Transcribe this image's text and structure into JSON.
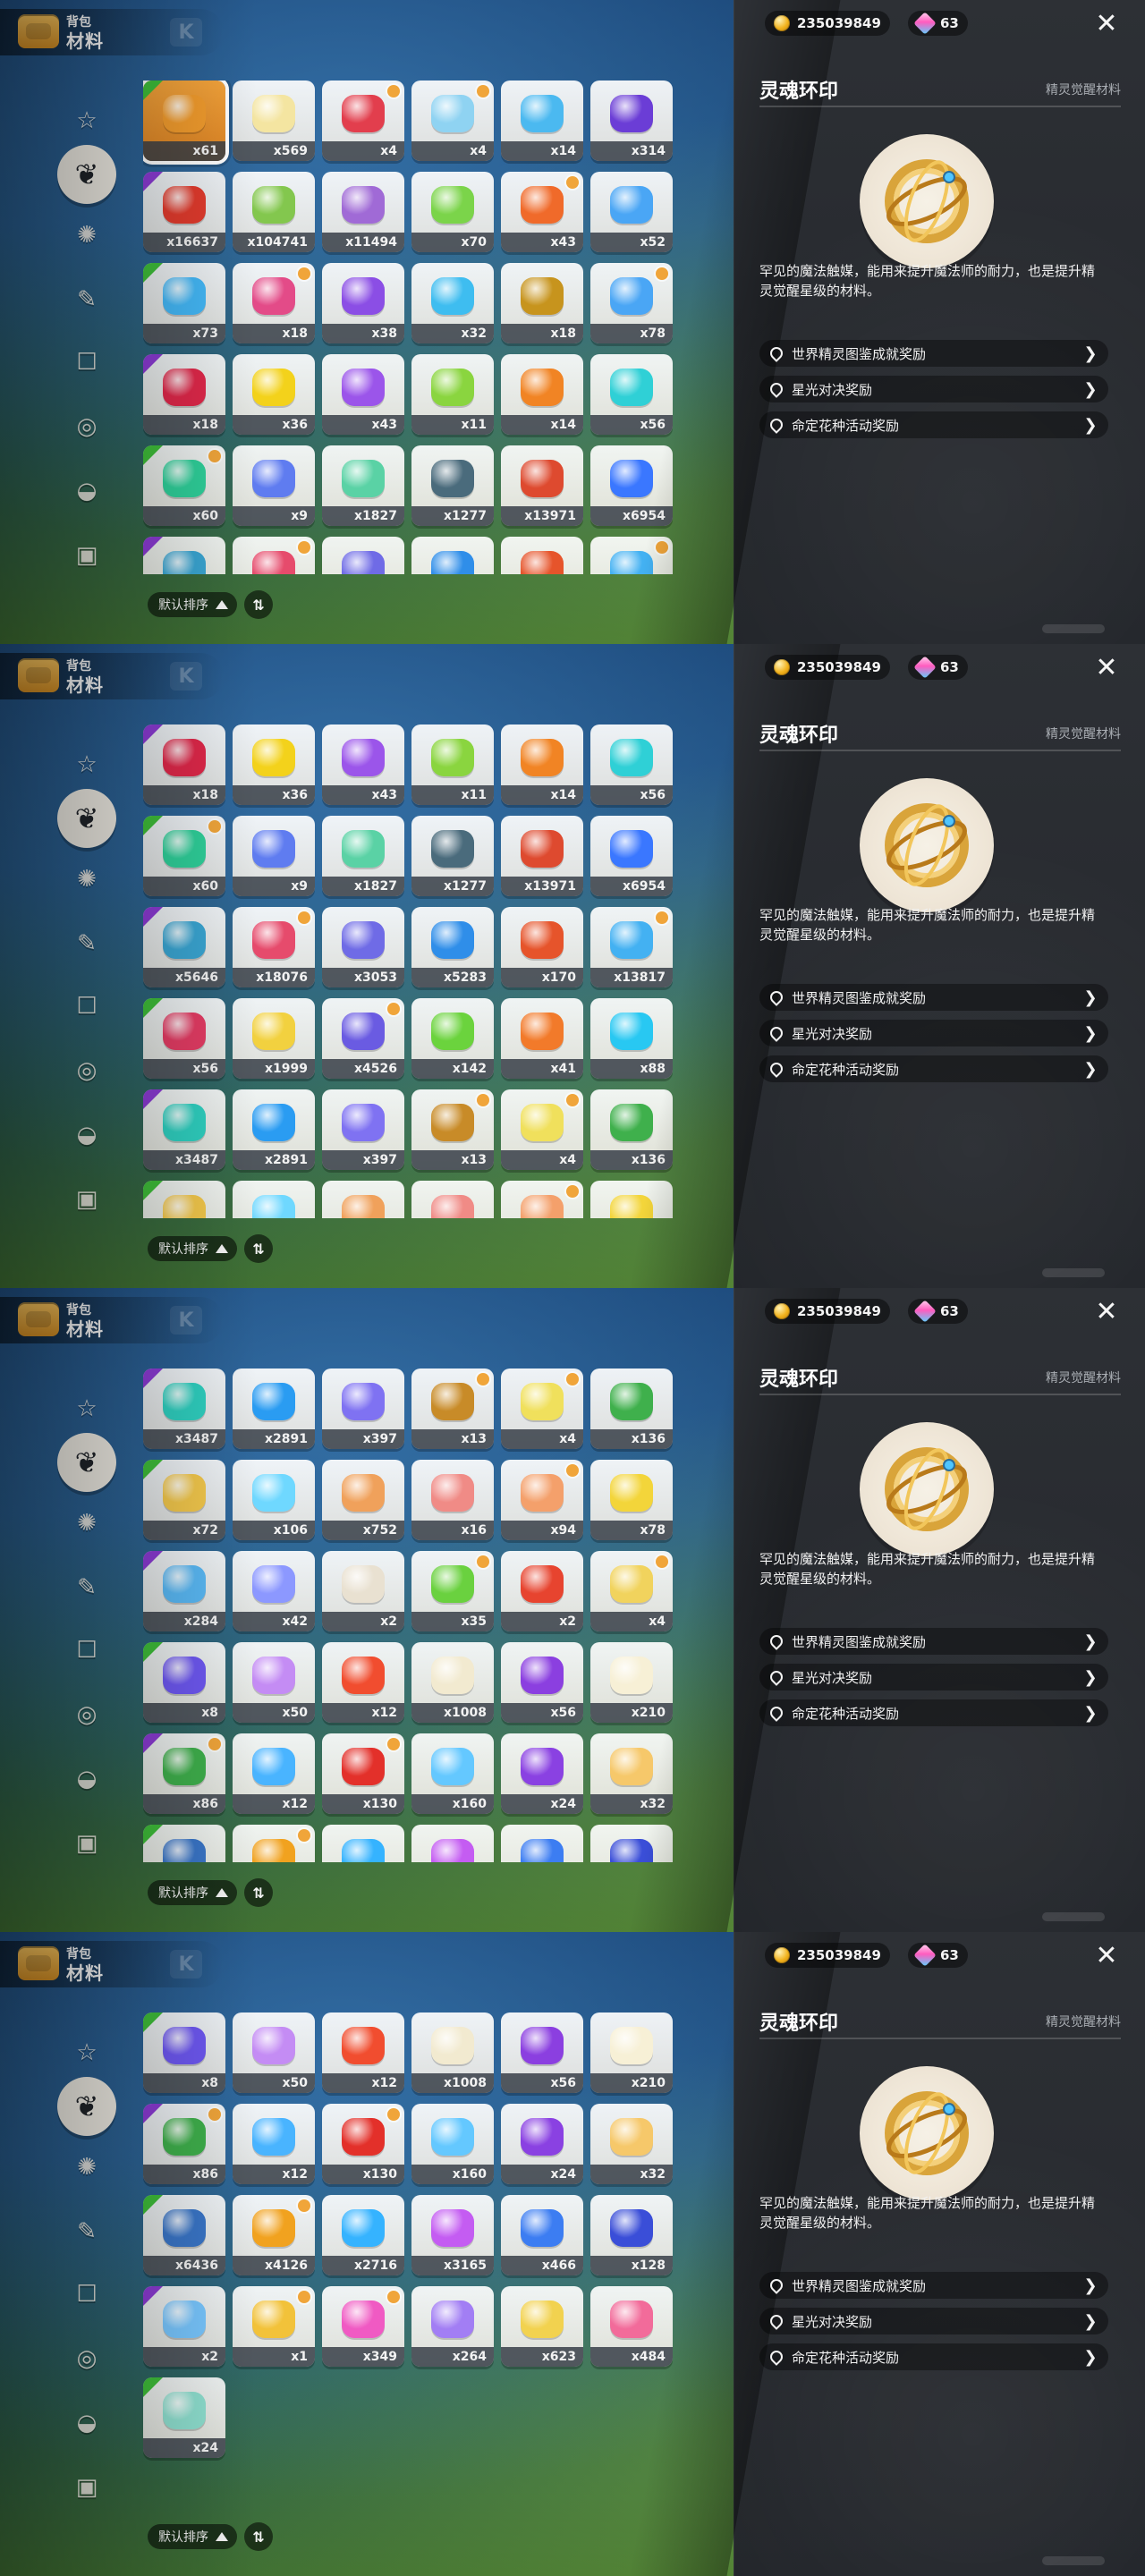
{
  "colors": {
    "purple_corner": "#8c3bd5",
    "green_corner": "#3fbf3a",
    "badge_orange": "#f0a53a"
  },
  "header": {
    "crumb": "背包",
    "title": "材料",
    "k_mark": "K"
  },
  "sidebar": {
    "icons": [
      "star-icon",
      "leaf-icon",
      "gear-flower-icon",
      "feather-leaf-icon",
      "scroll-icon",
      "swirl-icon",
      "acorn-icon",
      "treasure-chest-icon"
    ]
  },
  "sort": {
    "label": "默认排序",
    "order_icon": "⇅"
  },
  "right": {
    "currencies": [
      {
        "icon": "coin-icon",
        "value": "235039849"
      },
      {
        "icon": "gem-icon",
        "value": "63"
      }
    ],
    "close_icon": "close-icon",
    "close_glyph": "✕",
    "item_title": "灵魂环印",
    "item_category": "精灵觉醒材料",
    "description": "罕见的魔法触媒，能用来提升魔法师的耐力，也是提升精灵觉醒星级的材料。",
    "rewards": [
      {
        "label": "世界精灵图鉴成就奖励",
        "icon": "location-pin-icon"
      },
      {
        "label": "星光对决奖励",
        "icon": "location-pin-icon"
      },
      {
        "label": "命定花种活动奖励",
        "icon": "location-pin-icon"
      }
    ]
  },
  "inventory": {
    "items": [
      {
        "count": "x61",
        "color": "#f29c2d",
        "selected": true
      },
      {
        "count": "x569",
        "color": "#f4e5a1"
      },
      {
        "count": "x4",
        "color": "#e23e4d"
      },
      {
        "count": "x4",
        "color": "#8fd3f2"
      },
      {
        "count": "x14",
        "color": "#4bb9f0"
      },
      {
        "count": "x314",
        "color": "#6b3dd6"
      },
      {
        "count": "x16637",
        "color": "#e23b2d"
      },
      {
        "count": "x104741",
        "color": "#83c74e"
      },
      {
        "count": "x11494",
        "color": "#a06ad6"
      },
      {
        "count": "x70",
        "color": "#7bd44a"
      },
      {
        "count": "x43",
        "color": "#f06a2a"
      },
      {
        "count": "x52",
        "color": "#4aa6f5"
      },
      {
        "count": "x73",
        "color": "#44b8f7"
      },
      {
        "count": "x18",
        "color": "#e34b88"
      },
      {
        "count": "x38",
        "color": "#8b4ee5"
      },
      {
        "count": "x32",
        "color": "#3ebdf0"
      },
      {
        "count": "x18",
        "color": "#c7941d"
      },
      {
        "count": "x78",
        "color": "#4aa6f5"
      },
      {
        "count": "x18",
        "color": "#e0284a"
      },
      {
        "count": "x36",
        "color": "#f3d21b"
      },
      {
        "count": "x43",
        "color": "#9b55ea"
      },
      {
        "count": "x11",
        "color": "#8ad53f"
      },
      {
        "count": "x14",
        "color": "#f18424"
      },
      {
        "count": "x56",
        "color": "#2fd0d6"
      },
      {
        "count": "x60",
        "color": "#2fd09a"
      },
      {
        "count": "x9",
        "color": "#5f7cf0"
      },
      {
        "count": "x1827",
        "color": "#5ad2a5"
      },
      {
        "count": "x1277",
        "color": "#4a6b7c"
      },
      {
        "count": "x13971",
        "color": "#de4a2f"
      },
      {
        "count": "x6954",
        "color": "#3a77ff"
      },
      {
        "count": "x5646",
        "color": "#3aa6d3"
      },
      {
        "count": "x18076",
        "color": "#e64b6c"
      },
      {
        "count": "x3053",
        "color": "#6f6be6"
      },
      {
        "count": "x5283",
        "color": "#2f8ee9"
      },
      {
        "count": "x170",
        "color": "#e6542b"
      },
      {
        "count": "x13817",
        "color": "#43b1f2"
      },
      {
        "count": "x56",
        "color": "#e43c64"
      },
      {
        "count": "x1999",
        "color": "#f2d13f"
      },
      {
        "count": "x4526",
        "color": "#6a5be2"
      },
      {
        "count": "x142",
        "color": "#6bd33d"
      },
      {
        "count": "x41",
        "color": "#f27a2a"
      },
      {
        "count": "x88",
        "color": "#28c8f2"
      },
      {
        "count": "x3487",
        "color": "#2fd0c0"
      },
      {
        "count": "x2891",
        "color": "#2a9cf2"
      },
      {
        "count": "x397",
        "color": "#7f72f2"
      },
      {
        "count": "x13",
        "color": "#c88b28"
      },
      {
        "count": "x4",
        "color": "#f0e05c"
      },
      {
        "count": "x136",
        "color": "#3fb04c"
      },
      {
        "count": "x72",
        "color": "#f3c84c"
      },
      {
        "count": "x106",
        "color": "#6fd8ff"
      },
      {
        "count": "x752",
        "color": "#f0a15b"
      },
      {
        "count": "x16",
        "color": "#f08b86"
      },
      {
        "count": "x94",
        "color": "#f4a06b"
      },
      {
        "count": "x78",
        "color": "#f3d53a"
      },
      {
        "count": "x284",
        "color": "#5ab9f5"
      },
      {
        "count": "x42",
        "color": "#8c98ff"
      },
      {
        "count": "x2",
        "color": "#e9e1d1"
      },
      {
        "count": "x35",
        "color": "#6ad13f"
      },
      {
        "count": "x2",
        "color": "#e7442f"
      },
      {
        "count": "x4",
        "color": "#f1d35d"
      },
      {
        "count": "x8",
        "color": "#6e58f2"
      },
      {
        "count": "x50",
        "color": "#c48cf4"
      },
      {
        "count": "x12",
        "color": "#f14d2f"
      },
      {
        "count": "x1008",
        "color": "#f2ead0"
      },
      {
        "count": "x56",
        "color": "#8b3fe0"
      },
      {
        "count": "x210",
        "color": "#f7f0d6"
      },
      {
        "count": "x86",
        "color": "#3fb04c"
      },
      {
        "count": "x12",
        "color": "#49b4ff"
      },
      {
        "count": "x130",
        "color": "#e3302a"
      },
      {
        "count": "x160",
        "color": "#64c8ff"
      },
      {
        "count": "x24",
        "color": "#8a41e2"
      },
      {
        "count": "x32",
        "color": "#f6c86a"
      },
      {
        "count": "x6436",
        "color": "#3a76c8"
      },
      {
        "count": "x4126",
        "color": "#f1a21f"
      },
      {
        "count": "x2716",
        "color": "#35b3ff"
      },
      {
        "count": "x3165",
        "color": "#c45cf2"
      },
      {
        "count": "x466",
        "color": "#3c7df2"
      },
      {
        "count": "x128",
        "color": "#3a4ed8"
      },
      {
        "count": "x2",
        "color": "#79c7ff"
      },
      {
        "count": "x1",
        "color": "#f2c23a"
      },
      {
        "count": "x349",
        "color": "#f05ac3"
      },
      {
        "count": "x264",
        "color": "#a27ef4"
      },
      {
        "count": "x623",
        "color": "#f2d24f"
      },
      {
        "count": "x484",
        "color": "#f26b9a"
      },
      {
        "count": "x24",
        "color": "#8fe0d0"
      }
    ]
  }
}
